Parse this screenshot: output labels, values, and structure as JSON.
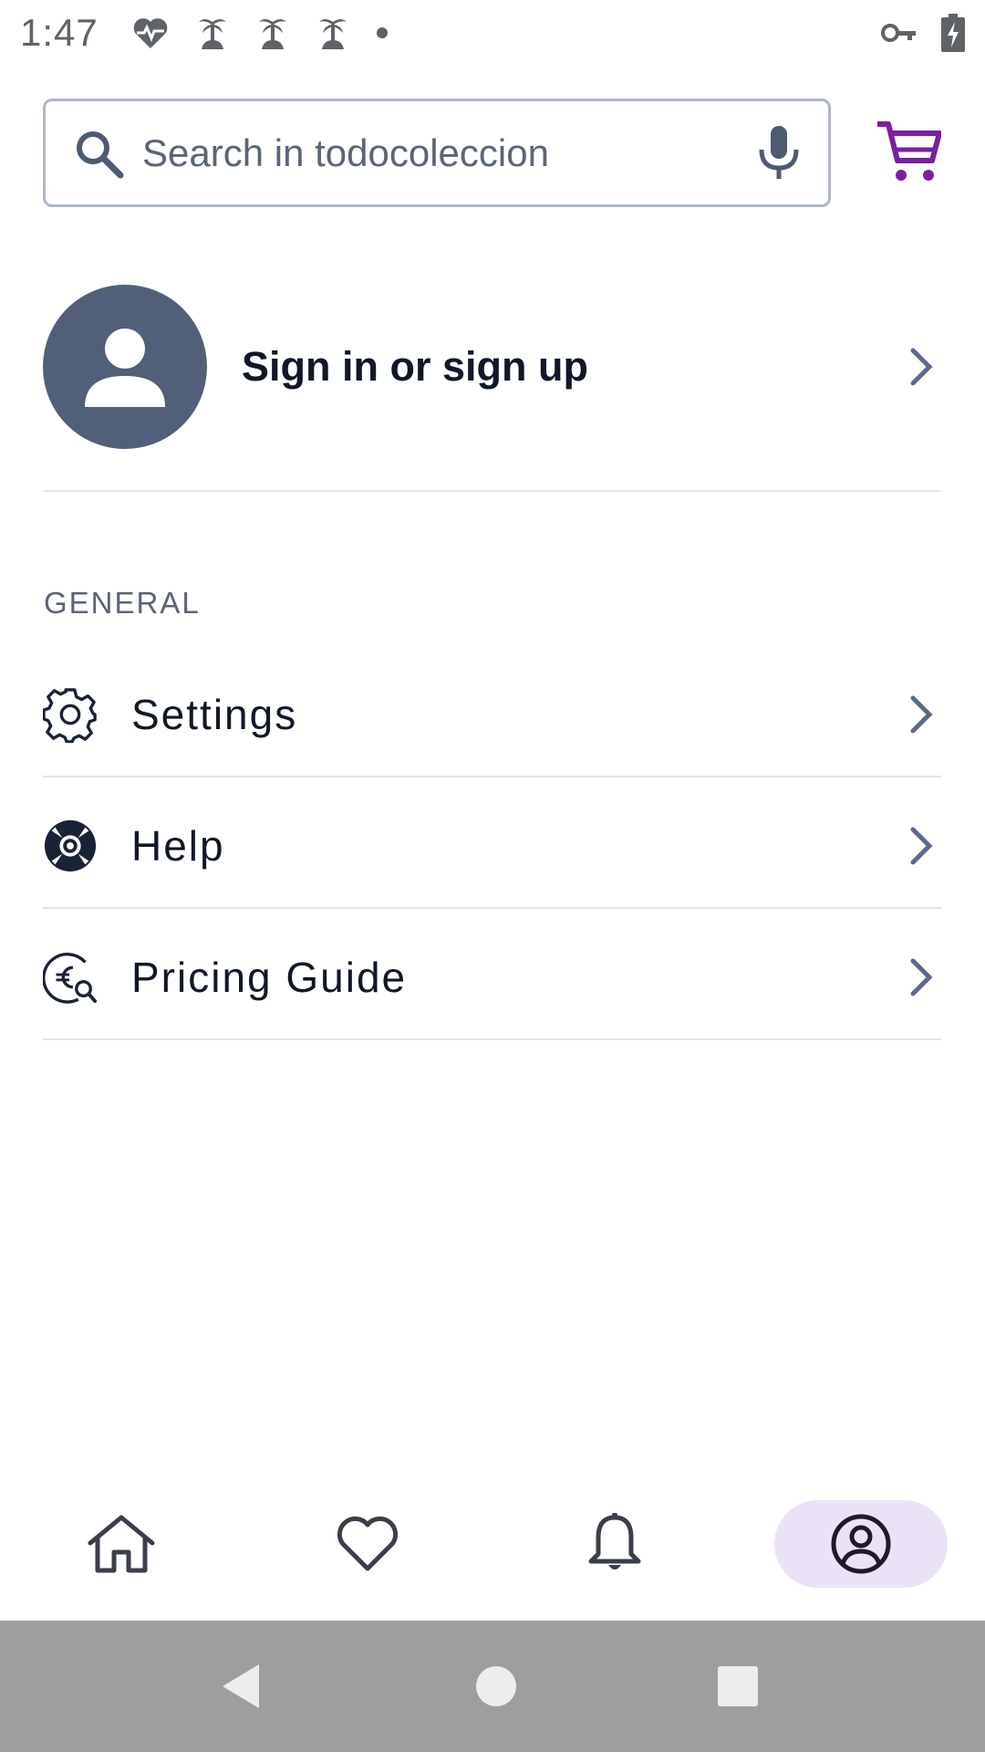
{
  "status_bar": {
    "time": "1:47",
    "left_icons": [
      "health-heart-icon",
      "palm-tree-icon",
      "palm-tree-icon",
      "palm-tree-icon",
      "dot-icon"
    ],
    "right_icons": [
      "vpn-key-icon",
      "battery-charging-icon"
    ]
  },
  "search": {
    "placeholder": "Search in todocoleccion"
  },
  "colors": {
    "cart": "#7b1fa2",
    "avatar_bg": "#515f78",
    "active_nav_bg": "#ebe2f7",
    "chevron": "#5b6b8c"
  },
  "profile": {
    "label": "Sign in or sign up"
  },
  "general": {
    "header": "GENERAL",
    "items": [
      {
        "label": "Settings",
        "icon": "gear-icon"
      },
      {
        "label": "Help",
        "icon": "lifebuoy-icon"
      },
      {
        "label": "Pricing Guide",
        "icon": "euro-search-icon"
      }
    ]
  },
  "bottom_nav": {
    "items": [
      {
        "icon": "home-icon",
        "active": false
      },
      {
        "icon": "heart-icon",
        "active": false
      },
      {
        "icon": "bell-icon",
        "active": false
      },
      {
        "icon": "account-icon",
        "active": true
      }
    ]
  }
}
